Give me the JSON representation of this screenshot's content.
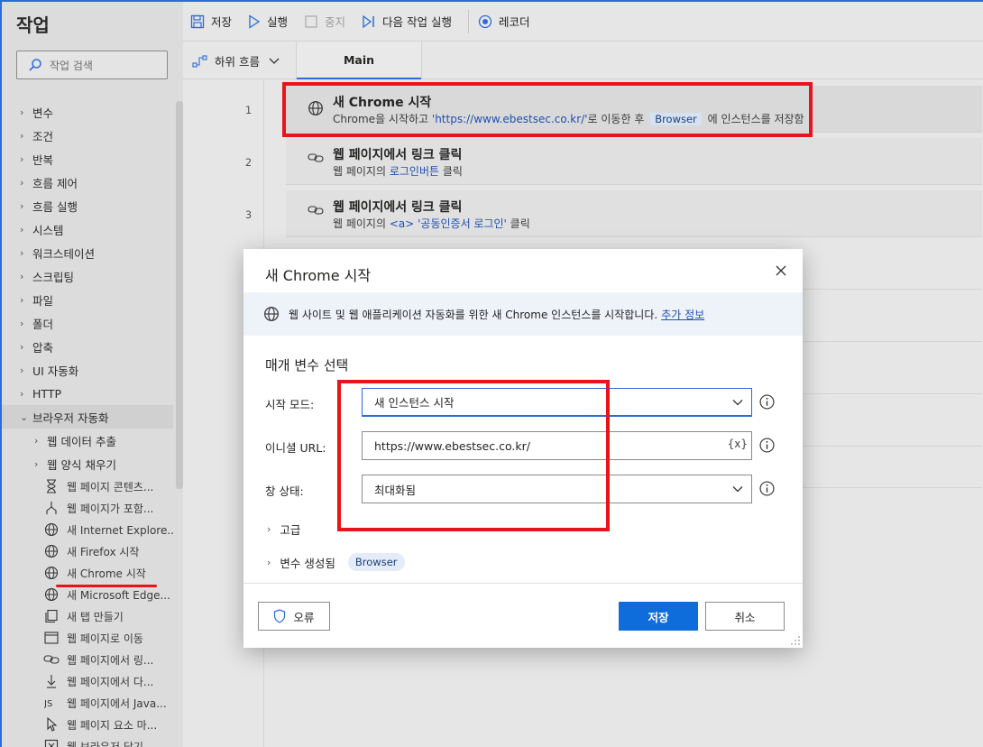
{
  "actions_pane": {
    "title": "작업",
    "search_placeholder": "작업 검색",
    "groups": [
      "변수",
      "조건",
      "반복",
      "흐름 제어",
      "흐름 실행",
      "시스템",
      "워크스테이션",
      "스크립팅",
      "파일",
      "폴더",
      "압축",
      "UI 자동화",
      "HTTP",
      "브라우저 자동화"
    ],
    "subgroups": [
      "웹 데이터 추출",
      "웹 양식 채우기"
    ],
    "leaves": [
      {
        "label": "웹 페이지 콘텐츠...",
        "icon": "hourglass-icon"
      },
      {
        "label": "웹 페이지가 포함...",
        "icon": "branch-icon"
      },
      {
        "label": "새 Internet Explore...",
        "icon": "globe-icon"
      },
      {
        "label": "새 Firefox 시작",
        "icon": "globe-icon"
      },
      {
        "label": "새 Chrome 시작",
        "icon": "globe-icon"
      },
      {
        "label": "새 Microsoft Edge...",
        "icon": "globe-icon"
      },
      {
        "label": "새 탭 만들기",
        "icon": "new-tab-icon"
      },
      {
        "label": "웹 페이지로 이동",
        "icon": "browser-window-icon"
      },
      {
        "label": "웹 페이지에서 링...",
        "icon": "link-icon"
      },
      {
        "label": "웹 페이지에서 다...",
        "icon": "download-icon"
      },
      {
        "label": "웹 페이지에서 Java...",
        "icon": "javascript-icon"
      },
      {
        "label": "웹 페이지 요소 마...",
        "icon": "cursor-icon"
      },
      {
        "label": "웹 브라우저 닫기",
        "icon": "close-box-icon"
      }
    ]
  },
  "toolbar": {
    "save": "저장",
    "run": "실행",
    "stop": "중지",
    "run_next": "다음 작업 실행",
    "recorder": "레코더"
  },
  "tabs": {
    "subflows": "하위 흐름",
    "main": "Main"
  },
  "steps": [
    {
      "num": "1",
      "title": "새 Chrome 시작",
      "desc_pre": "Chrome을 시작하고 ",
      "desc_link": "'https://www.ebestsec.co.kr/'",
      "desc_mid": "로 이동한 후 ",
      "desc_chip": "Browser",
      "desc_post": " 에 인스턴스를 저장함",
      "icon": "globe-icon"
    },
    {
      "num": "2",
      "title": "웹 페이지에서 링크 클릭",
      "desc_pre": "웹 페이지의 ",
      "desc_link": "로그인버튼",
      "desc_post": " 클릭",
      "icon": "link-icon"
    },
    {
      "num": "3",
      "title": "웹 페이지에서 링크 클릭",
      "desc_pre": "웹 페이지의 ",
      "desc_link": "<a> '공동인증서 로그인'",
      "desc_post": " 클릭",
      "icon": "link-icon"
    }
  ],
  "dialog": {
    "title": "새 Chrome 시작",
    "info": "웹 사이트 및 웹 애플리케이션 자동화를 위한 새 Chrome 인스턴스를 시작합니다.",
    "info_link": "추가 정보",
    "section": "매개 변수 선택",
    "launch_mode_label": "시작 모드:",
    "launch_mode_value": "새 인스턴스 시작",
    "url_label": "이니셜 URL:",
    "url_value": "https://www.ebestsec.co.kr/",
    "var_button": "{x}",
    "window_state_label": "창 상태:",
    "window_state_value": "최대화됨",
    "advanced": "고급",
    "vars_produced": "변수 생성됨",
    "vars_chip": "Browser",
    "error_button": "오류",
    "save_button": "저장",
    "cancel_button": "취소"
  },
  "colors": {
    "accent": "#0f6cdb",
    "highlight_red": "#e8141c",
    "link_blue": "#1f4fb4"
  }
}
